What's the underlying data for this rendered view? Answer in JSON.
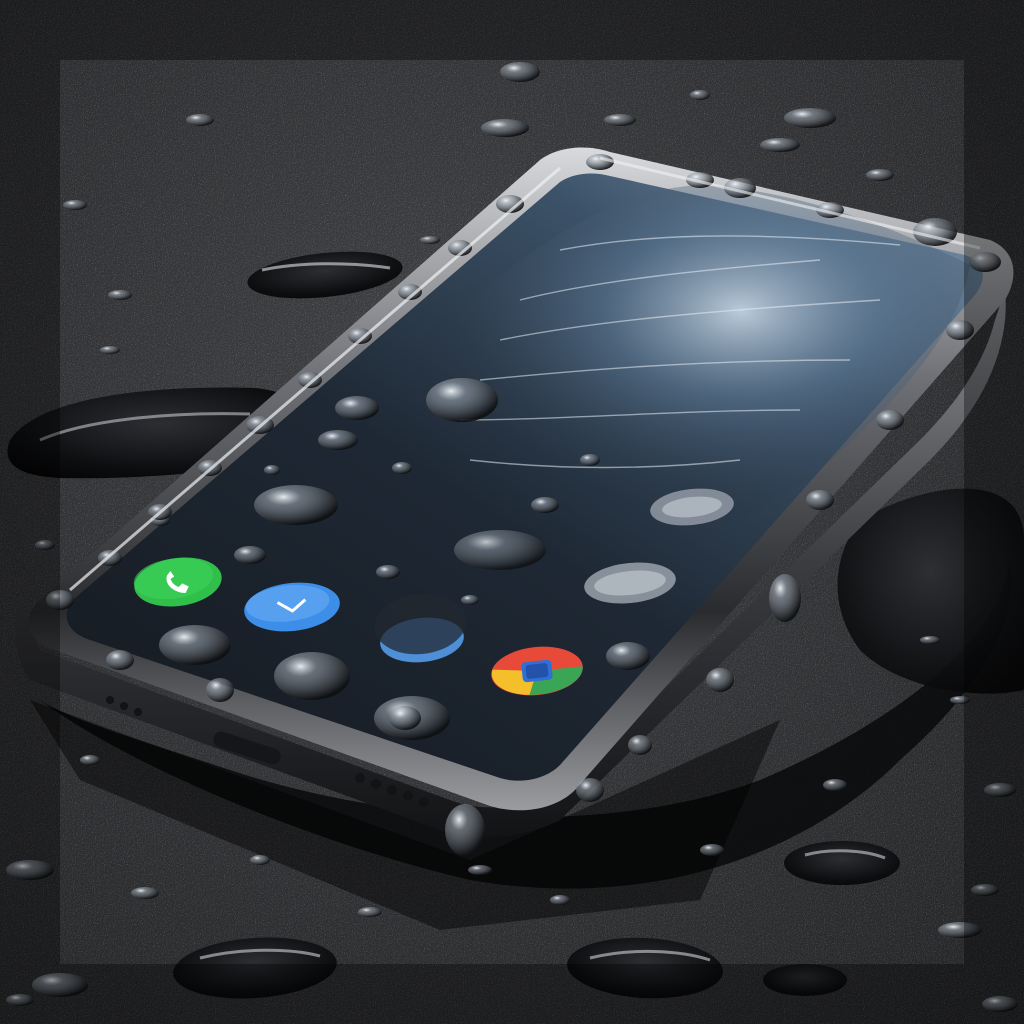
{
  "scene": {
    "subject": "wet-smartphone-in-puddle",
    "colors": {
      "ground_dark": "#0c0d0f",
      "ground_mid": "#3a3b3e",
      "ground_light": "#7c7e82",
      "frame_metal": "#6e7075",
      "frame_highlight": "#d8dadd",
      "screen_dark": "#1a2230",
      "screen_glow": "#5f7b96",
      "water_highlight": "#f2f6fa"
    },
    "app_icons": [
      {
        "name": "phone-app-icon",
        "color": "#2fbf4a"
      },
      {
        "name": "mail-app-icon",
        "color": "#3c8ee8"
      },
      {
        "name": "blue-app-icon",
        "color": "#4f8fd6"
      },
      {
        "name": "chrome-app-icon",
        "color": "#e84a3a"
      },
      {
        "name": "grey-app-icon",
        "color": "#9aa2ab"
      },
      {
        "name": "grey-app-icon-2",
        "color": "#8c95a0"
      }
    ]
  }
}
